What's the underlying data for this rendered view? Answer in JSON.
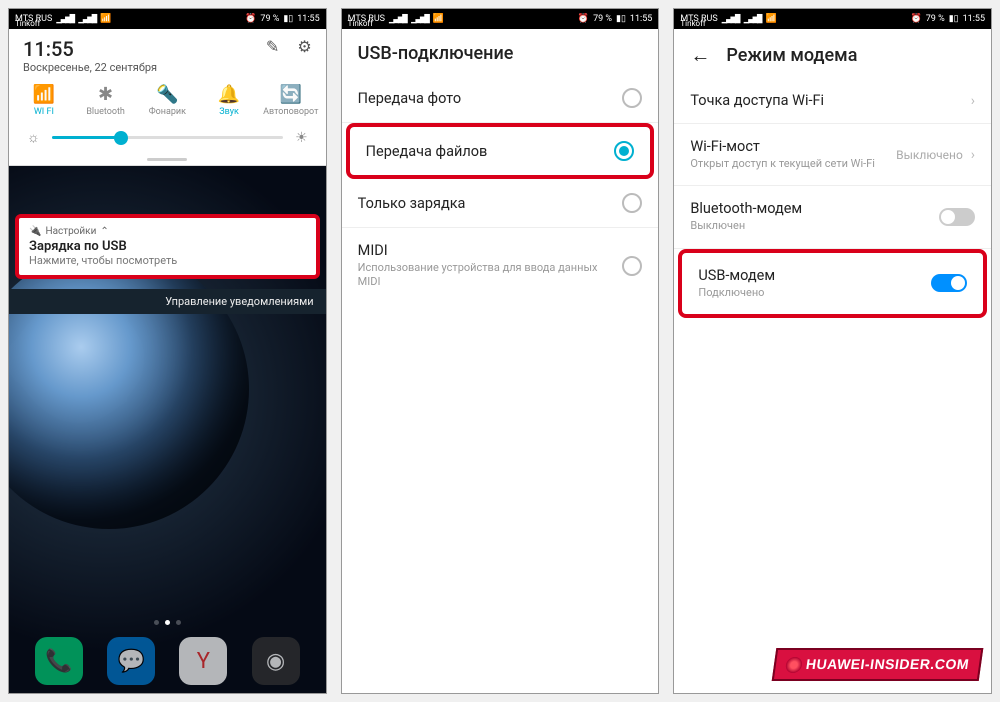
{
  "statusbar": {
    "carrier1": "MTS RUS",
    "carrier2": "Tinkoff",
    "alarm": "⏰",
    "battery_pct": "79 %",
    "time": "11:55"
  },
  "phone1": {
    "time": "11:55",
    "date": "Воскресенье, 22 сентября",
    "edit_icon": "✎",
    "gear_icon": "⚙",
    "tiles": [
      {
        "icon": "📶",
        "label": "WI FI",
        "active": true
      },
      {
        "icon": "✱",
        "label": "Bluetooth",
        "active": false
      },
      {
        "icon": "🔦",
        "label": "Фонарик",
        "active": false
      },
      {
        "icon": "🔔",
        "label": "Звук",
        "active": true
      },
      {
        "icon": "🔄",
        "label": "Автоповорот",
        "active": false
      }
    ],
    "notification": {
      "app_icon": "🔌",
      "app_name": "Настройки",
      "chevron": "⌃",
      "title": "Зарядка по USB",
      "subtitle": "Нажмите, чтобы посмотреть"
    },
    "manage_notifications": "Управление уведомлениями",
    "dock": [
      {
        "name": "phone-app",
        "bg": "#0c7",
        "glyph": "📞"
      },
      {
        "name": "messages-app",
        "bg": "#07c",
        "glyph": "💬"
      },
      {
        "name": "yandex-app",
        "bg": "#fff",
        "glyph": "Y",
        "txt": "#e33"
      },
      {
        "name": "camera-app",
        "bg": "#333",
        "glyph": "◉"
      }
    ]
  },
  "phone2": {
    "header": "USB-подключение",
    "options": [
      {
        "title": "Передача фото",
        "checked": false
      },
      {
        "title": "Передача файлов",
        "checked": true,
        "highlight": true
      },
      {
        "title": "Только зарядка",
        "checked": false
      },
      {
        "title": "MIDI",
        "sub": "Использование устройства для ввода данных MIDI",
        "checked": false
      }
    ]
  },
  "phone3": {
    "header": "Режим модема",
    "options": [
      {
        "title": "Точка доступа Wi-Fi",
        "type": "nav"
      },
      {
        "title": "Wi-Fi-мост",
        "sub": "Открыт доступ к текущей сети Wi-Fi",
        "right": "Выключено",
        "type": "nav"
      },
      {
        "title": "Bluetooth-модем",
        "sub": "Выключен",
        "type": "toggle",
        "on": false
      },
      {
        "title": "USB-модем",
        "sub": "Подключено",
        "type": "toggle",
        "on": true,
        "highlight": true
      }
    ]
  },
  "watermark": "HUAWEI-INSIDER.COM"
}
